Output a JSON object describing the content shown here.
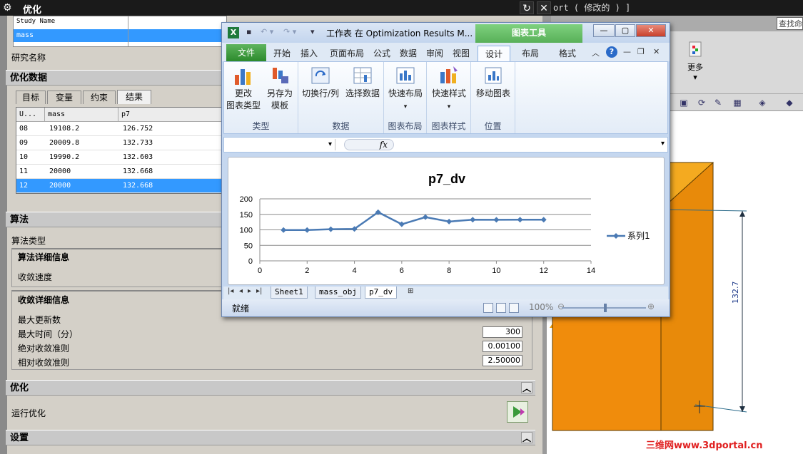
{
  "nx": {
    "dialog_title": "优化",
    "doc_title": "ort ( 修改的 ) ]",
    "search_text": "查找命",
    "study": {
      "column_header": "Study Name",
      "selected_value": "mass",
      "name_label": "研究名称"
    },
    "opt_data_header": "优化数据",
    "tabs": [
      "目标",
      "变量",
      "约束",
      "结果"
    ],
    "results": {
      "columns": [
        "U...",
        "mass",
        "p7"
      ],
      "rows": [
        [
          "08",
          "19108.2",
          "126.752"
        ],
        [
          "09",
          "20009.8",
          "132.733"
        ],
        [
          "10",
          "19990.2",
          "132.603"
        ],
        [
          "11",
          "20000",
          "132.668"
        ],
        [
          "12",
          "20000",
          "132.668"
        ]
      ]
    },
    "algorithm_header": "算法",
    "algorithm_type_label": "算法类型",
    "algo_details_title": "算法详细信息",
    "convergence_speed_label": "收敛速度",
    "conv_details_title": "收敛详细信息",
    "max_updates_label": "最大更新数",
    "max_time_label": "最大时间（分）",
    "max_time_value": "300",
    "abs_criteria_label": "绝对收敛准则",
    "abs_criteria_value": "0.00100",
    "rel_criteria_label": "相对收敛准则",
    "rel_criteria_value": "2.50000",
    "optimize_header": "优化",
    "run_label": "运行优化",
    "settings_header": "设置",
    "more_label": "更多",
    "dimension_label": "132.7",
    "watermark": "三维网www.3dportal.cn"
  },
  "excel": {
    "window_title": "工作表 在 Optimization Results M...",
    "context_tab": "图表工具",
    "tabs": [
      "文件",
      "开始",
      "插入",
      "页面布局",
      "公式",
      "数据",
      "审阅",
      "视图",
      "设计",
      "布局",
      "格式"
    ],
    "ribbon_groups": [
      {
        "label": "类型",
        "buttons": [
          "更改\n图表类型",
          "另存为\n模板"
        ]
      },
      {
        "label": "数据",
        "buttons": [
          "切换行/列",
          "选择数据"
        ]
      },
      {
        "label": "图表布局",
        "buttons": [
          "快速布局"
        ]
      },
      {
        "label": "图表样式",
        "buttons": [
          "快速样式"
        ]
      },
      {
        "label": "位置",
        "buttons": [
          "移动图表"
        ]
      }
    ],
    "fx_label": "fx",
    "sheet_tabs": [
      "Sheet1",
      "mass_obj",
      "p7_dv"
    ],
    "active_sheet": "p7_dv",
    "status": "就绪",
    "zoom": "100%"
  },
  "chart_data": {
    "type": "line",
    "title": "p7_dv",
    "x": [
      1,
      2,
      3,
      4,
      5,
      6,
      7,
      8,
      9,
      10,
      11,
      12
    ],
    "series": [
      {
        "name": "系列1",
        "values": [
          99.5,
          99.5,
          102,
          103,
          157,
          118,
          141,
          126.752,
          132.733,
          132.603,
          132.668,
          132.668
        ]
      }
    ],
    "xlim": [
      0,
      14
    ],
    "ylim": [
      0,
      200
    ],
    "xticks": [
      0,
      2,
      4,
      6,
      8,
      10,
      12,
      14
    ],
    "yticks": [
      0,
      50,
      100,
      150,
      200
    ],
    "grid": true,
    "legend": "right",
    "color": "#4a7ab4"
  }
}
